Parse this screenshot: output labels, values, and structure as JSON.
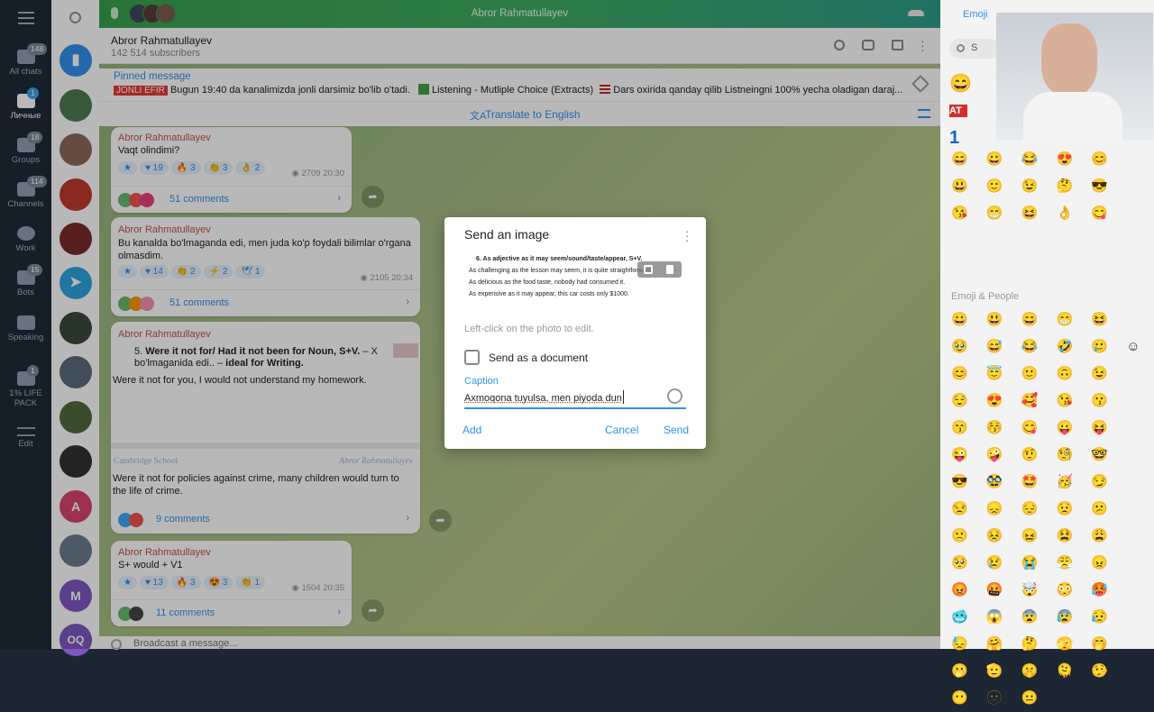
{
  "folders": [
    {
      "label": "All chats",
      "badge": "148",
      "active": false
    },
    {
      "label": "Личные",
      "badge": "1",
      "active": true
    },
    {
      "label": "Groups",
      "badge": "18",
      "active": false
    },
    {
      "label": "Channels",
      "badge": "114",
      "active": false
    },
    {
      "label": "Work",
      "badge": "",
      "active": false
    },
    {
      "label": "Bots",
      "badge": "15",
      "active": false
    },
    {
      "label": "Speaking",
      "badge": "",
      "active": false
    },
    {
      "label": "1% LIFE PACK",
      "badge": "1",
      "active": false
    },
    {
      "label": "Edit",
      "badge": "",
      "active": false
    }
  ],
  "chat_list": {
    "letter_avatars": [
      "A",
      "M",
      "OQ"
    ]
  },
  "call": {
    "title": "Abror Rahmatullayev"
  },
  "channel": {
    "name": "Abror Rahmatullayev",
    "subscribers": "142 514 subscribers"
  },
  "pinned": {
    "title": "Pinned message",
    "live_tag": "JONLI EFIR",
    "text1": "Bugun 19:40 da kanalimizda jonli darsimiz bo'lib o'tadi.",
    "text2": "Listening - Mutliple Choice (Extracts)",
    "text3": "Dars oxirida qanday qilib Listneingni 100% yecha oladigan daraj..."
  },
  "translate": {
    "label": "Translate to English"
  },
  "messages": [
    {
      "author": "Abror Rahmatullayev",
      "text": "Vaqt olindimi?",
      "reactions": [
        "★",
        "♥ 19",
        "🔥 3",
        "👏 3",
        "👌 2"
      ],
      "views": "2709",
      "time": "20:30",
      "comments": "51 comments"
    },
    {
      "author": "Abror Rahmatullayev",
      "text": "Bu kanalda bo'lmaganda edi, men juda ko'p foydali bilimlar o'rgana olmasdim.",
      "reactions": [
        "★",
        "♥ 14",
        "👏 2",
        "⚡ 2",
        "🕊 1"
      ],
      "views": "2105",
      "time": "20:34",
      "comments": "51 comments"
    },
    {
      "author": "Abror Rahmatullayev",
      "rule": "5. Were it not for/ Had it not been for Noun, S+V. – X bo'lmaganida edi.. – ideal for Writing.",
      "rule_bold": "Were it not for/ Had it not been for Noun, S+V.",
      "rule_tail": " – X bo'lmaganida edi.. – ",
      "rule_ideal": "ideal for Writing.",
      "example": "Were it not for you, I would not understand my homework.",
      "school": "Cambridge School",
      "school_author": "Abror Rahmatullayev",
      "example2": "Were it not for policies against crime, many children would turn to the life of crime.",
      "comments": "9 comments"
    },
    {
      "author": "Abror Rahmatullayev",
      "text": "S+ would + V1",
      "reactions": [
        "★",
        "♥ 13",
        "🔥 3",
        "😍 3",
        "👏 1"
      ],
      "views": "1504",
      "time": "20:35",
      "comments": "11 comments"
    }
  ],
  "composer": {
    "placeholder": "Broadcast a message..."
  },
  "emoji_panel": {
    "tab": "Emoji",
    "search": "S",
    "section": "Emoji & People",
    "recent": "😄 😀 😂 😍 😊 😃 🙂 😉 🤔 😎 😘 😁 😆 👌 😋",
    "people": "😀 😃 😄 😁 😆 🥹 😅 😂 🤣 🥲 ☺ 😊 😇 🙂 🙃 😉 😌 😍 🥰 😘 😗 😙 😚 😋 😛 😝 😜 🤪 🤨 🧐 🤓 😎 🥸 🤩 🥳 😏 😒 😞 😔 😟 😕 🙁 😣 😖 😫 😩 🥺 😢 😭 😤 😠 😡 🤬 🤯 😳 🥵 🥶 😱 😨 😰 😥 😓 🤗 🤔 🫣 🤭 🫢 🫡 🤫 🫠 🤥 😶 🫥 😐"
  },
  "dialog": {
    "title": "Send an image",
    "image_lines": [
      "6. As adjective as it may seem/sound/taste/appear, S+V.",
      "As challenging as the lesson may seem, it is quite straightforward.",
      "As delicious as the food taste, nobody had consumed it.",
      "As expensive as it may appear, this car costs only $1000."
    ],
    "hint": "Left-click on the photo to edit.",
    "send_as_document": "Send as a document",
    "caption_label": "Caption",
    "caption_value": "Axmoqona tuyulsa, men piyoda dun",
    "add": "Add",
    "cancel": "Cancel",
    "send": "Send"
  },
  "colors": {
    "accent": "#3390ec",
    "call_green": "#3aa04f",
    "author_red": "#c84e4e",
    "live_red": "#e53935"
  }
}
